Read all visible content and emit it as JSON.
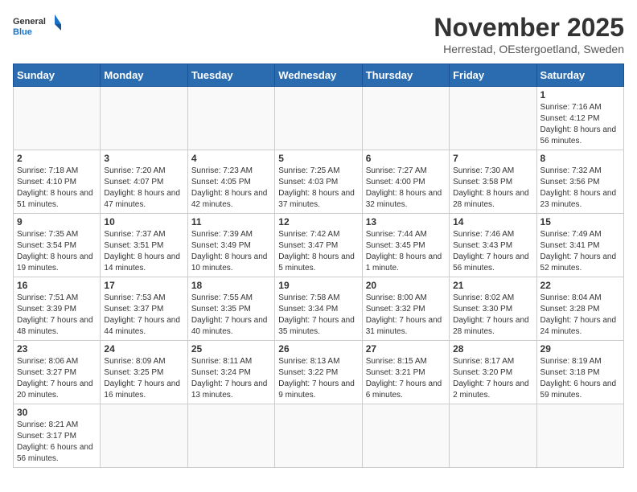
{
  "header": {
    "logo_general": "General",
    "logo_blue": "Blue",
    "month_title": "November 2025",
    "subtitle": "Herrestad, OEstergoetland, Sweden"
  },
  "weekdays": [
    "Sunday",
    "Monday",
    "Tuesday",
    "Wednesday",
    "Thursday",
    "Friday",
    "Saturday"
  ],
  "weeks": [
    [
      {
        "day": "",
        "info": ""
      },
      {
        "day": "",
        "info": ""
      },
      {
        "day": "",
        "info": ""
      },
      {
        "day": "",
        "info": ""
      },
      {
        "day": "",
        "info": ""
      },
      {
        "day": "",
        "info": ""
      },
      {
        "day": "1",
        "info": "Sunrise: 7:16 AM\nSunset: 4:12 PM\nDaylight: 8 hours and 56 minutes."
      }
    ],
    [
      {
        "day": "2",
        "info": "Sunrise: 7:18 AM\nSunset: 4:10 PM\nDaylight: 8 hours and 51 minutes."
      },
      {
        "day": "3",
        "info": "Sunrise: 7:20 AM\nSunset: 4:07 PM\nDaylight: 8 hours and 47 minutes."
      },
      {
        "day": "4",
        "info": "Sunrise: 7:23 AM\nSunset: 4:05 PM\nDaylight: 8 hours and 42 minutes."
      },
      {
        "day": "5",
        "info": "Sunrise: 7:25 AM\nSunset: 4:03 PM\nDaylight: 8 hours and 37 minutes."
      },
      {
        "day": "6",
        "info": "Sunrise: 7:27 AM\nSunset: 4:00 PM\nDaylight: 8 hours and 32 minutes."
      },
      {
        "day": "7",
        "info": "Sunrise: 7:30 AM\nSunset: 3:58 PM\nDaylight: 8 hours and 28 minutes."
      },
      {
        "day": "8",
        "info": "Sunrise: 7:32 AM\nSunset: 3:56 PM\nDaylight: 8 hours and 23 minutes."
      }
    ],
    [
      {
        "day": "9",
        "info": "Sunrise: 7:35 AM\nSunset: 3:54 PM\nDaylight: 8 hours and 19 minutes."
      },
      {
        "day": "10",
        "info": "Sunrise: 7:37 AM\nSunset: 3:51 PM\nDaylight: 8 hours and 14 minutes."
      },
      {
        "day": "11",
        "info": "Sunrise: 7:39 AM\nSunset: 3:49 PM\nDaylight: 8 hours and 10 minutes."
      },
      {
        "day": "12",
        "info": "Sunrise: 7:42 AM\nSunset: 3:47 PM\nDaylight: 8 hours and 5 minutes."
      },
      {
        "day": "13",
        "info": "Sunrise: 7:44 AM\nSunset: 3:45 PM\nDaylight: 8 hours and 1 minute."
      },
      {
        "day": "14",
        "info": "Sunrise: 7:46 AM\nSunset: 3:43 PM\nDaylight: 7 hours and 56 minutes."
      },
      {
        "day": "15",
        "info": "Sunrise: 7:49 AM\nSunset: 3:41 PM\nDaylight: 7 hours and 52 minutes."
      }
    ],
    [
      {
        "day": "16",
        "info": "Sunrise: 7:51 AM\nSunset: 3:39 PM\nDaylight: 7 hours and 48 minutes."
      },
      {
        "day": "17",
        "info": "Sunrise: 7:53 AM\nSunset: 3:37 PM\nDaylight: 7 hours and 44 minutes."
      },
      {
        "day": "18",
        "info": "Sunrise: 7:55 AM\nSunset: 3:35 PM\nDaylight: 7 hours and 40 minutes."
      },
      {
        "day": "19",
        "info": "Sunrise: 7:58 AM\nSunset: 3:34 PM\nDaylight: 7 hours and 35 minutes."
      },
      {
        "day": "20",
        "info": "Sunrise: 8:00 AM\nSunset: 3:32 PM\nDaylight: 7 hours and 31 minutes."
      },
      {
        "day": "21",
        "info": "Sunrise: 8:02 AM\nSunset: 3:30 PM\nDaylight: 7 hours and 28 minutes."
      },
      {
        "day": "22",
        "info": "Sunrise: 8:04 AM\nSunset: 3:28 PM\nDaylight: 7 hours and 24 minutes."
      }
    ],
    [
      {
        "day": "23",
        "info": "Sunrise: 8:06 AM\nSunset: 3:27 PM\nDaylight: 7 hours and 20 minutes."
      },
      {
        "day": "24",
        "info": "Sunrise: 8:09 AM\nSunset: 3:25 PM\nDaylight: 7 hours and 16 minutes."
      },
      {
        "day": "25",
        "info": "Sunrise: 8:11 AM\nSunset: 3:24 PM\nDaylight: 7 hours and 13 minutes."
      },
      {
        "day": "26",
        "info": "Sunrise: 8:13 AM\nSunset: 3:22 PM\nDaylight: 7 hours and 9 minutes."
      },
      {
        "day": "27",
        "info": "Sunrise: 8:15 AM\nSunset: 3:21 PM\nDaylight: 7 hours and 6 minutes."
      },
      {
        "day": "28",
        "info": "Sunrise: 8:17 AM\nSunset: 3:20 PM\nDaylight: 7 hours and 2 minutes."
      },
      {
        "day": "29",
        "info": "Sunrise: 8:19 AM\nSunset: 3:18 PM\nDaylight: 6 hours and 59 minutes."
      }
    ],
    [
      {
        "day": "30",
        "info": "Sunrise: 8:21 AM\nSunset: 3:17 PM\nDaylight: 6 hours and 56 minutes."
      },
      {
        "day": "",
        "info": ""
      },
      {
        "day": "",
        "info": ""
      },
      {
        "day": "",
        "info": ""
      },
      {
        "day": "",
        "info": ""
      },
      {
        "day": "",
        "info": ""
      },
      {
        "day": "",
        "info": ""
      }
    ]
  ]
}
